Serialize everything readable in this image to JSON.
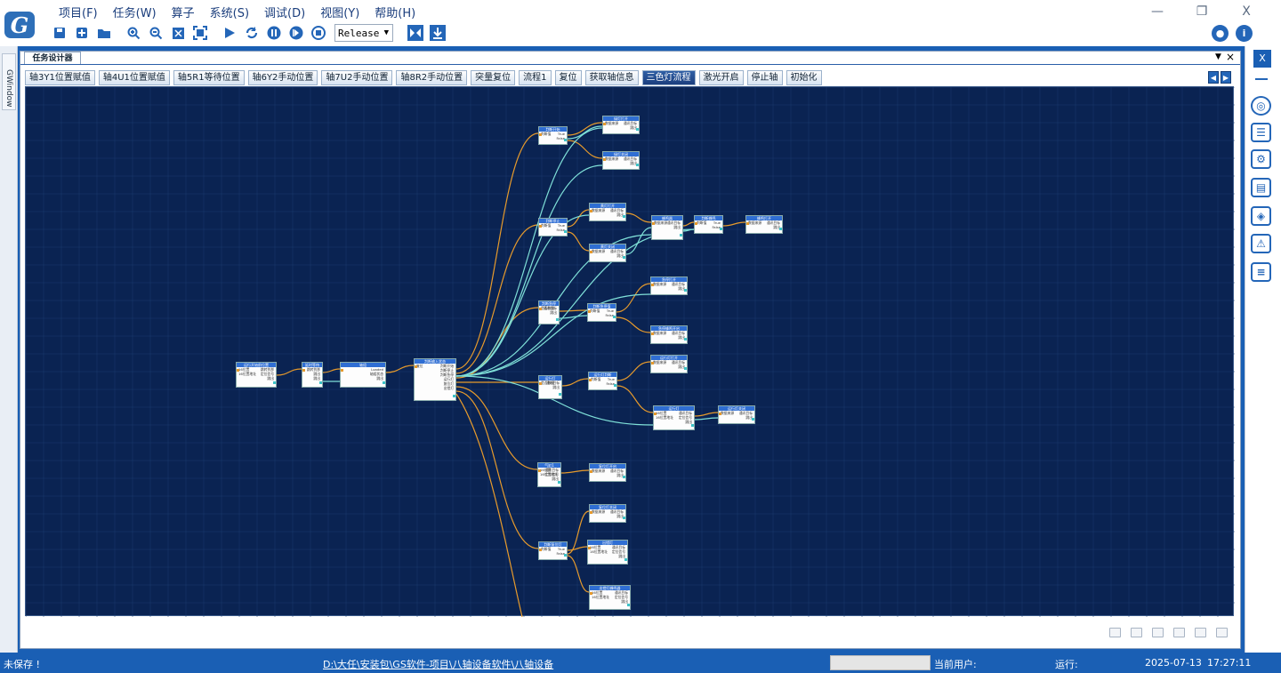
{
  "menu": [
    "项目(F)",
    "任务(W)",
    "算子",
    "系统(S)",
    "调试(D)",
    "视图(Y)",
    "帮助(H)"
  ],
  "logo_text": "G",
  "window_buttons": {
    "minimize": "—",
    "restore": "❐",
    "close": "X"
  },
  "build_config": "Release",
  "left_panel_tab": "GWindow",
  "document_tab": "任务设计器",
  "doc_controls": {
    "dropdown": "▼",
    "close": "×"
  },
  "tabs": [
    "轴3Y1位置赋值",
    "轴4U1位置赋值",
    "轴5R1等待位置",
    "轴6Y2手动位置",
    "轴7U2手动位置",
    "轴8R2手动位置",
    "突量复位",
    "流程1",
    "复位",
    "获取轴信息",
    "三色灯流程",
    "激光开启",
    "停止轴",
    "初始化"
  ],
  "active_tab": "三色灯流程",
  "tab_scroll": {
    "left": "◀",
    "right": "▶"
  },
  "right_panel_close": "X",
  "status": {
    "unsaved": "未保存 !",
    "path": "D:\\大任\\安装包\\GS软件-项目\\八轴设备软件\\八轴设备",
    "current_user_label": "当前用户:",
    "running_label": "运行:",
    "date": "2025-07-13",
    "time": "17:27:11"
  },
  "flow_nodes": [
    {
      "title": "运行开始前位置",
      "rows": [
        [
          "16位置",
          "跳转到那"
        ],
        [
          "16位置地址",
          "定位信号"
        ],
        [
          "",
          "跳出"
        ]
      ]
    },
    {
      "title": "延时等待",
      "rows": [
        [
          "",
          "跳转到那"
        ],
        [
          "",
          "跳出"
        ],
        [
          "",
          "跳出"
        ]
      ]
    },
    {
      "title": "轴组",
      "rows": [
        [
          "",
          "Loaded"
        ],
        [
          "",
          "轴组状态"
        ],
        [
          "",
          "跳出"
        ]
      ]
    },
    {
      "title": "判断输入状态",
      "rows": [
        [
          "复位",
          "判断开始"
        ],
        [
          "",
          "判断停止"
        ],
        [
          "",
          "判断急停"
        ],
        [
          "",
          "运行灯"
        ],
        [
          "",
          "复位灯"
        ],
        [
          "",
          "出错灯"
        ]
      ]
    },
    {
      "title": "判断开始",
      "rows": [
        [
          "判断值",
          "True"
        ],
        [
          "",
          "False"
        ]
      ]
    },
    {
      "title": "绿灯打开",
      "rows": [
        [
          "数据来源",
          "通讯目标"
        ],
        [
          "",
          "跳出"
        ]
      ]
    },
    {
      "title": "绿灯关闭",
      "rows": [
        [
          "数据来源",
          "通讯目标"
        ],
        [
          "",
          "跳出"
        ]
      ]
    },
    {
      "title": "判断停止",
      "rows": [
        [
          "判断值",
          "True"
        ],
        [
          "",
          "False"
        ]
      ]
    },
    {
      "title": "黄灯打开",
      "rows": [
        [
          "数据来源",
          "通讯目标"
        ],
        [
          "",
          "跳出"
        ]
      ]
    },
    {
      "title": "黄灯关闭",
      "rows": [
        [
          "数据来源",
          "通讯目标"
        ],
        [
          "",
          "跳出"
        ]
      ]
    },
    {
      "title": "蜂鸣器",
      "rows": [
        [
          "数据来源",
          "通讯目标"
        ],
        [
          "",
          "跳出"
        ]
      ]
    },
    {
      "title": "判断蜂鸣",
      "rows": [
        [
          "判断值",
          "True"
        ],
        [
          "",
          "False"
        ]
      ]
    },
    {
      "title": "蜂鸣打开",
      "rows": [
        [
          "数据来源",
          "通讯目标"
        ],
        [
          "",
          "跳出"
        ]
      ]
    },
    {
      "title": "判断急停",
      "rows": [
        [
          "是否数据",
          "通讯目标"
        ],
        [
          "",
          "跳出"
        ]
      ]
    },
    {
      "title": "判断急停值",
      "rows": [
        [
          "判断值",
          "True"
        ],
        [
          "",
          "False"
        ]
      ]
    },
    {
      "title": "急停打开",
      "rows": [
        [
          "数据来源",
          "通讯目标"
        ],
        [
          "",
          "跳出"
        ]
      ]
    },
    {
      "title": "急停蜂鸣开启",
      "rows": [
        [
          "数据来源",
          "通讯目标"
        ],
        [
          "",
          "跳出"
        ]
      ]
    },
    {
      "title": "运行灯",
      "rows": [
        [
          "是否数据",
          "通讯目标"
        ],
        [
          "",
          "跳出"
        ]
      ]
    },
    {
      "title": "运行灯判断",
      "rows": [
        [
          "判断值",
          "True"
        ],
        [
          "",
          "False"
        ]
      ]
    },
    {
      "title": "运行灯打开",
      "rows": [
        [
          "数据来源",
          "通讯目标"
        ],
        [
          "",
          "跳出"
        ]
      ]
    },
    {
      "title": "运行灯",
      "rows": [
        [
          "16位置",
          "通讯目标"
        ],
        [
          "16位置地址",
          "定位信号"
        ],
        [
          "",
          "跳出"
        ]
      ]
    },
    {
      "title": "运行灯关闭",
      "rows": [
        [
          "数据来源",
          "通讯目标"
        ],
        [
          "",
          "跳出"
        ]
      ]
    },
    {
      "title": "气缸1",
      "rows": [
        [
          "16位置",
          "通讯目标"
        ],
        [
          "16位置地址",
          "定位信号"
        ],
        [
          "",
          "跳出"
        ]
      ]
    },
    {
      "title": "复位灯开启",
      "rows": [
        [
          "数据来源",
          "通讯目标"
        ],
        [
          "",
          "跳出"
        ]
      ]
    },
    {
      "title": "复位灯关闭",
      "rows": [
        [
          "数据来源",
          "通讯目标"
        ],
        [
          "",
          "跳出"
        ]
      ]
    },
    {
      "title": "判断复位灯",
      "rows": [
        [
          "判断值",
          "True"
        ],
        [
          "",
          "False"
        ]
      ]
    },
    {
      "title": "出错灯",
      "rows": [
        [
          "16位置",
          "通讯目标"
        ],
        [
          "16位置地址",
          "定位信号"
        ],
        [
          "",
          "跳出"
        ]
      ]
    },
    {
      "title": "出错灯蜂鸣器",
      "rows": [
        [
          "16位置",
          "通讯目标"
        ],
        [
          "16位置地址",
          "定位信号"
        ],
        [
          "",
          "跳出"
        ]
      ]
    }
  ],
  "colors": {
    "canvas": "#0a2352",
    "grid": "#1b3a6e",
    "link_orange": "#e69a2c",
    "link_cyan": "#7fe0d8",
    "node_header": "#2f6ed3",
    "accent": "#1a5fb4"
  },
  "icons": [
    "save-icon",
    "new-icon",
    "open-folder-icon",
    "zoom-in-icon",
    "zoom-out-icon",
    "fit-icon",
    "fullscreen-icon",
    "run-icon",
    "loop-icon",
    "pause-icon",
    "step-icon",
    "stop-icon",
    "breakpoint-icon",
    "download-icon",
    "user-icon",
    "info-icon",
    "network-icon",
    "checklist-icon",
    "settings-list-icon",
    "panel-icon",
    "layers-icon",
    "warning-icon",
    "list-icon"
  ]
}
